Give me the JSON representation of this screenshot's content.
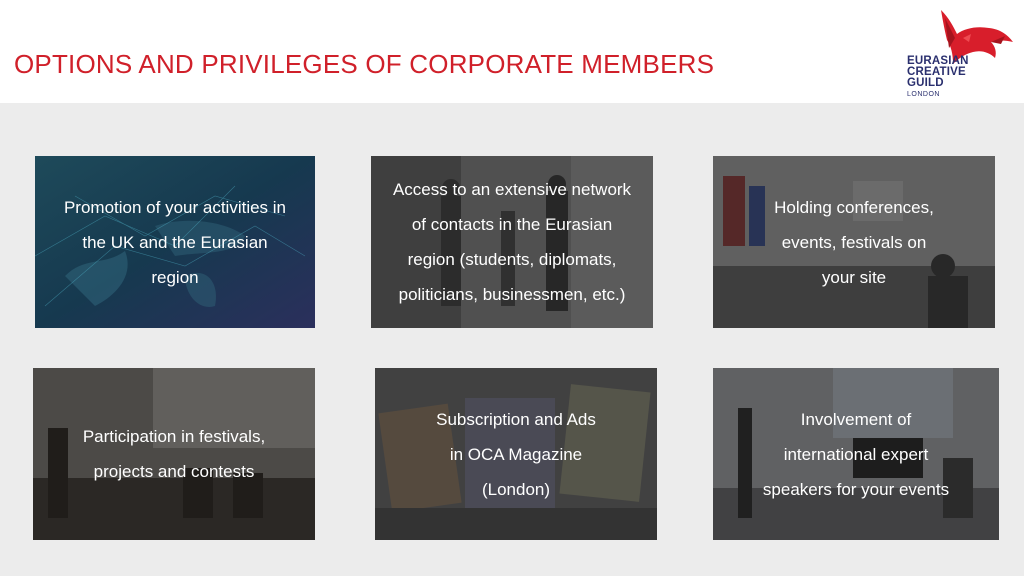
{
  "header": {
    "title": "OPTIONS AND PRIVILEGES OF CORPORATE MEMBERS",
    "logo": {
      "line1": "EURASIAN",
      "line2": "CREATIVE",
      "line3": "GUILD",
      "line4": "LONDON",
      "icon": "red-bird-icon"
    }
  },
  "colors": {
    "title": "#d0202a",
    "logo_text": "#2a2f6e",
    "background": "#ececec"
  },
  "cards": [
    {
      "text": "Promotion of your activities in\nthe UK and the Eurasian\nregion",
      "image": "world-map-network"
    },
    {
      "text": "Access to an extensive network\nof contacts in the Eurasian\nregion (students, diplomats,\npoliticians, businessmen, etc.)",
      "image": "people-networking"
    },
    {
      "text": "Holding conferences,\nevents, festivals on\nyour site",
      "image": "conference-room-flags"
    },
    {
      "text": "Participation in festivals,\nprojects and contests",
      "image": "panel-on-stage"
    },
    {
      "text": "Subscription and Ads\nin OCA Magazine\n(London)",
      "image": "magazines"
    },
    {
      "text": "Involvement of\ninternational expert\nspeakers for your events",
      "image": "speaker-at-piano"
    }
  ]
}
